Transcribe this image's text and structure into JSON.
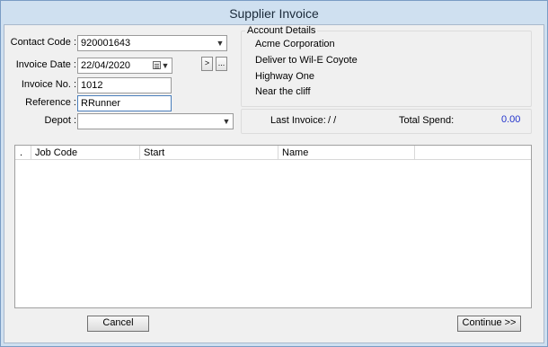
{
  "window": {
    "title": "Supplier Invoice"
  },
  "form": {
    "contact_code_label": "Contact Code :",
    "contact_code_value": "920001643",
    "invoice_date_label": "Invoice Date :",
    "invoice_date_value": "22/04/2020",
    "invoice_no_label": "Invoice No. :",
    "invoice_no_value": "1012",
    "reference_label": "Reference :",
    "reference_value": "RRunner",
    "depot_label": "Depot :",
    "depot_value": "",
    "next_button_label": ">",
    "more_button_label": "..."
  },
  "account": {
    "legend": "Account Details",
    "lines": [
      "Acme Corporation",
      "Deliver to Wil-E Coyote",
      "Highway One",
      "Near the cliff"
    ],
    "last_invoice_label": "Last Invoice:",
    "last_invoice_value": "/ /",
    "total_spend_label": "Total Spend:",
    "total_spend_value": "0.00",
    "total_spend_color": "#2233cc"
  },
  "grid": {
    "columns": [
      ".",
      "Job Code",
      "Start",
      "Name"
    ]
  },
  "footer": {
    "cancel_label": "Cancel",
    "continue_label": "Continue >>"
  }
}
